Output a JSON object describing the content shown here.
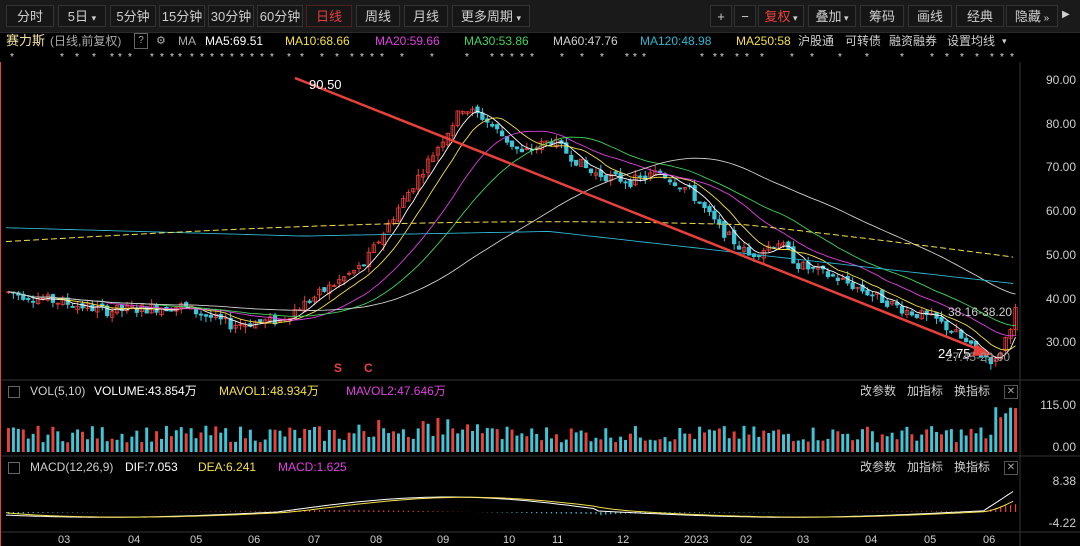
{
  "toolbar": {
    "periods": [
      "分时",
      "5日",
      "5分钟",
      "15分钟",
      "30分钟",
      "60分钟",
      "日线",
      "周线",
      "月线",
      "更多周期"
    ],
    "active_period": "日线",
    "tools": [
      "+",
      "−",
      "复权",
      "叠加",
      "筹码",
      "画线",
      "经典",
      "隐藏"
    ],
    "more_icon": "double-chevron-right-icon"
  },
  "stock": {
    "name": "赛力斯",
    "mode": "(日线,前复权)",
    "help": "?",
    "ma_label": "MA",
    "ma5": "MA5:69.51",
    "ma10": "MA10:68.66",
    "ma20": "MA20:59.66",
    "ma30": "MA30:53.86",
    "ma60": "MA60:47.76",
    "ma120": "MA120:48.98",
    "ma250": "MA250:58",
    "extra": [
      "沪股通",
      "可转债",
      "融资融券",
      "设置均线"
    ]
  },
  "colors": {
    "up": "#e8413c",
    "down": "#3ec6d8",
    "ma5": "#ffffff",
    "ma10": "#f5e04a",
    "ma20": "#e040e0",
    "ma30": "#41d55a",
    "ma60": "#cfcfcf",
    "ma120": "#2fb6d0",
    "ma250": "#f5e04a",
    "trend_line": "#e8413c"
  },
  "price_axis": [
    "90.00",
    "80.00",
    "70.00",
    "60.00",
    "50.00",
    "40.00",
    "30.00"
  ],
  "annotations": {
    "high": "90.50",
    "low": "24.75",
    "range1": "38.16-38.20",
    "range2": "27.45-29.00",
    "marks": [
      "S",
      "C"
    ]
  },
  "volume": {
    "title": "VOL(5,10)",
    "volume": "VOLUME:43.854万",
    "mavol1": "MAVOL1:48.934万",
    "mavol2": "MAVOL2:47.646万",
    "axis": [
      "115.00",
      "0.00"
    ],
    "buttons": [
      "改参数",
      "加指标",
      "换指标"
    ]
  },
  "macd": {
    "title": "MACD(12,26,9)",
    "dif": "DIF:7.053",
    "dea": "DEA:6.241",
    "macd": "MACD:1.625",
    "axis": [
      "8.38",
      "-4.22"
    ],
    "buttons": [
      "改参数",
      "加指标",
      "换指标"
    ]
  },
  "x_axis": [
    "03",
    "04",
    "05",
    "06",
    "07",
    "08",
    "09",
    "10",
    "11",
    "12",
    "2023",
    "02",
    "03",
    "04",
    "05",
    "06"
  ]
}
